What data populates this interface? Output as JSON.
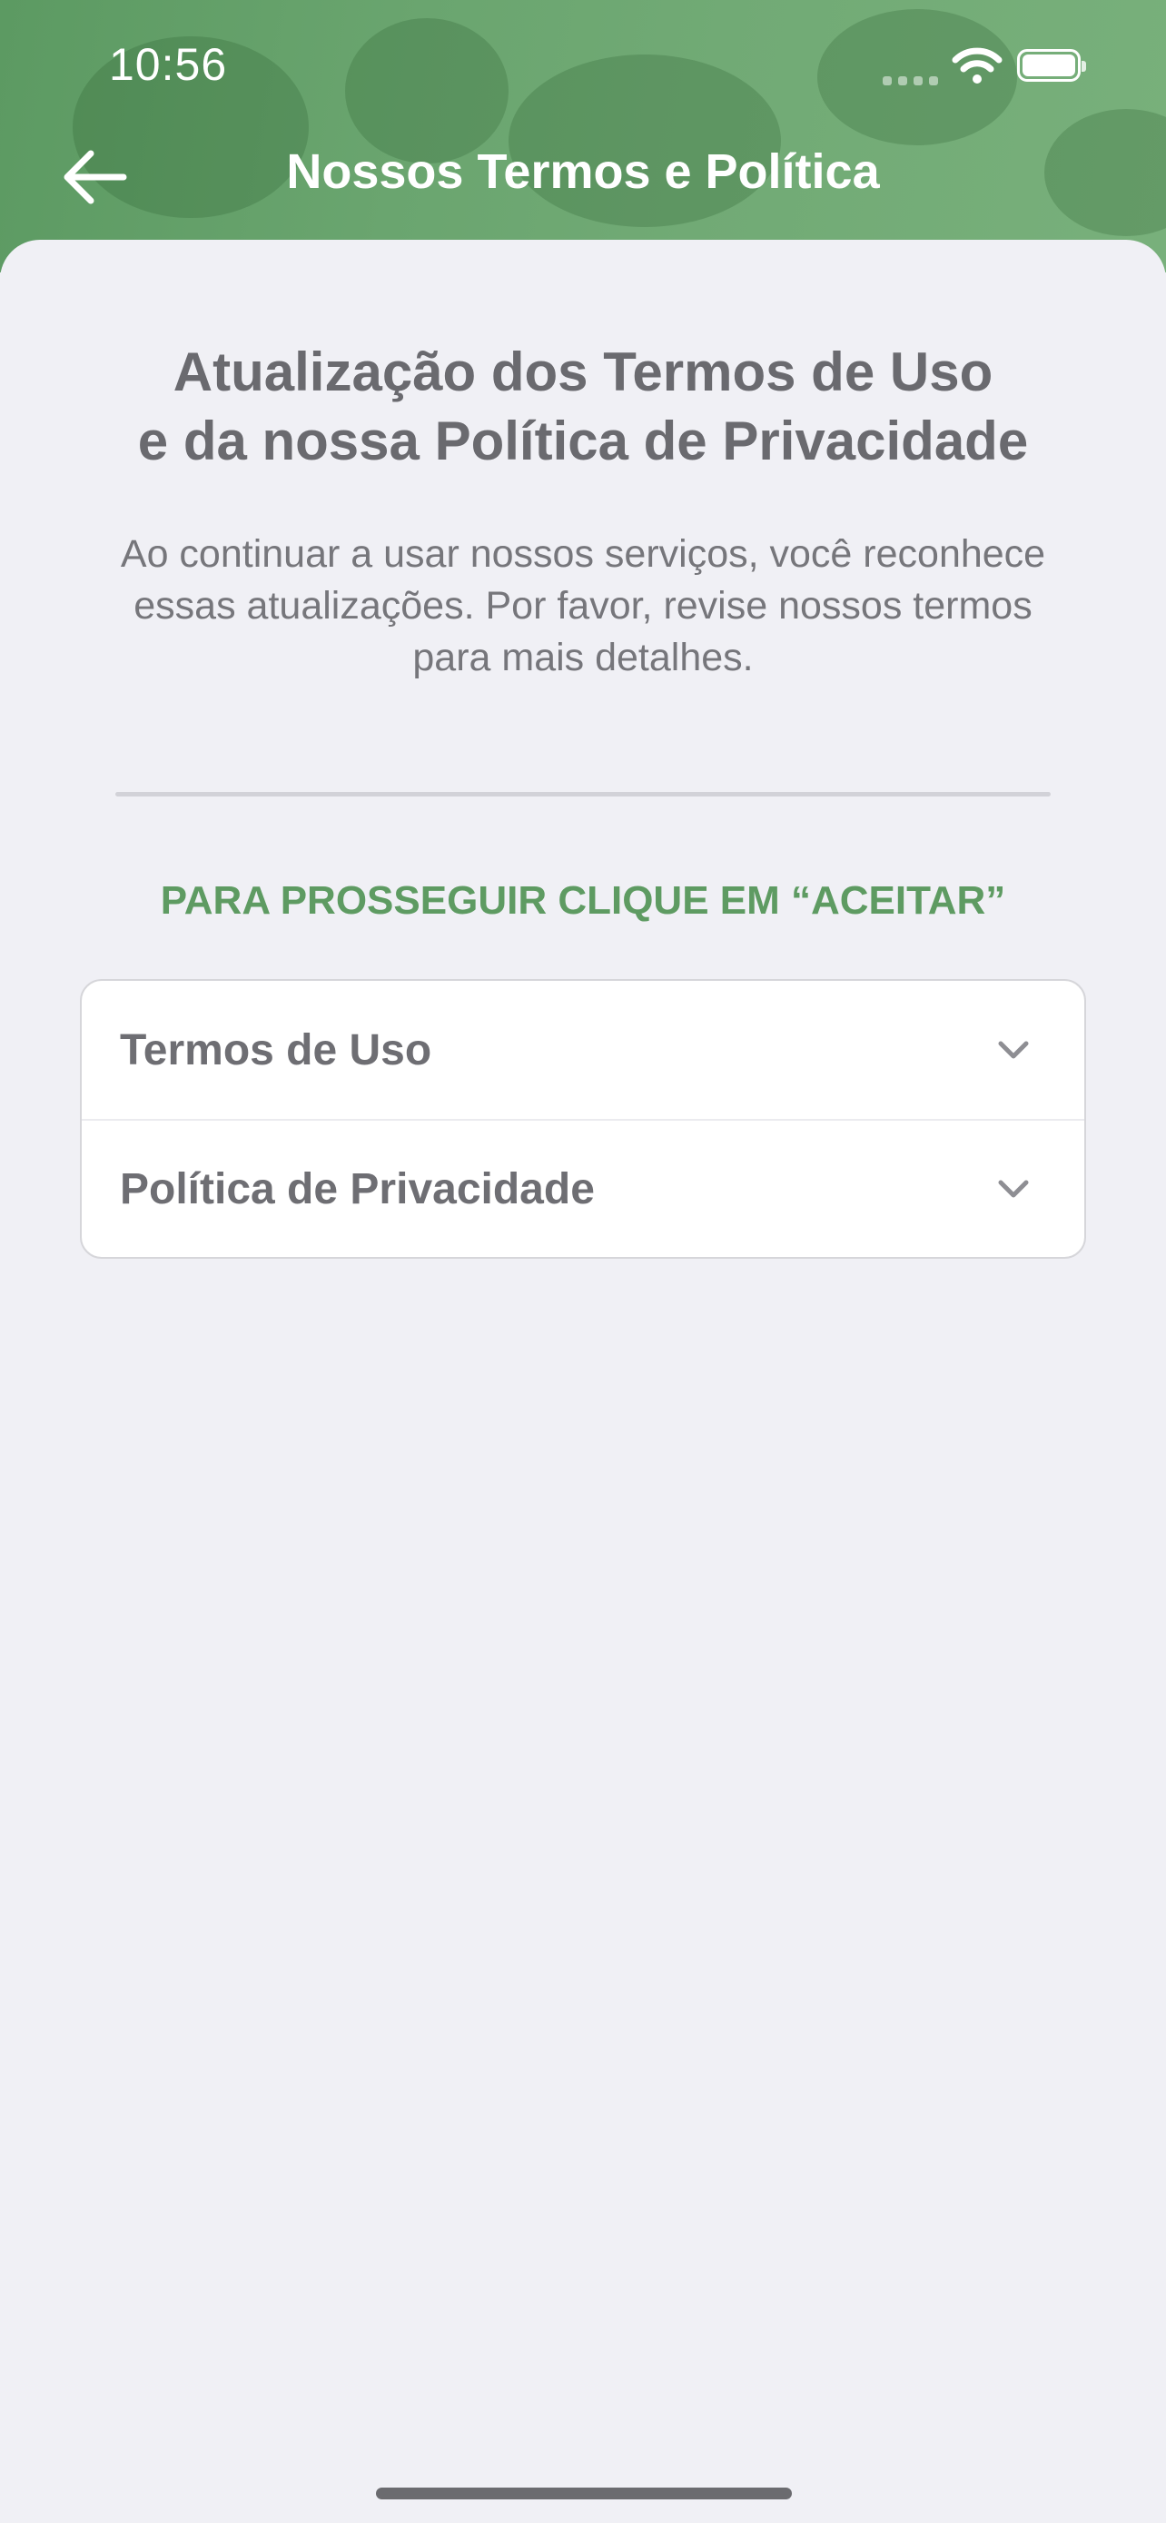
{
  "status_bar": {
    "time": "10:56"
  },
  "header": {
    "title": "Nossos Termos e Política"
  },
  "main": {
    "title": "Atualização dos Termos de Uso\ne da nossa Política de Privacidade",
    "description": "Ao continuar a usar nossos serviços, você reconhece essas atualizações. Por favor, revise nossos termos para mais detalhes.",
    "instruction": "PARA PROSSEGUIR CLIQUE EM “ACEITAR”",
    "sections": [
      {
        "label": "Termos de Uso",
        "icon": "chevron-down-icon"
      },
      {
        "label": "Política de Privacidade",
        "icon": "chevron-down-icon"
      }
    ]
  },
  "colors": {
    "accent": "#5e9b62",
    "header_green": "#6aa56f",
    "text_gray": "#6a6a6f",
    "background": "#f0f0f5"
  }
}
